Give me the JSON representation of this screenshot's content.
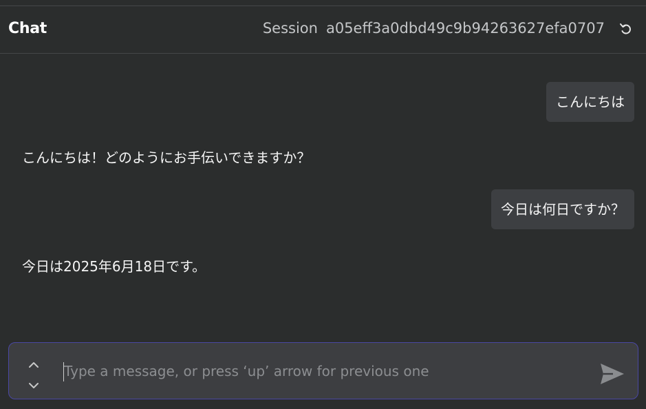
{
  "header": {
    "title": "Chat",
    "session_label": "Session",
    "session_id": "a05eff3a0dbd49c9b94263627efa0707"
  },
  "icons": {
    "reset": "reset-icon",
    "history_up": "chevron-up-icon",
    "history_down": "chevron-down-icon",
    "send": "send-icon"
  },
  "messages": [
    {
      "role": "user",
      "text": "こんにちは"
    },
    {
      "role": "assistant",
      "text": "こんにちは！どのようにお手伝いできますか？"
    },
    {
      "role": "user",
      "text": "今日は何日ですか？"
    },
    {
      "role": "assistant",
      "text": "今日は2025年6月18日です。"
    }
  ],
  "input": {
    "value": "",
    "placeholder": "Type a message, or press ‘up’ arrow for previous one"
  },
  "colors": {
    "background": "#2b2d2d",
    "bubble": "#3d3f42",
    "input_border": "#4a47a3",
    "send_icon": "#8a8c8f"
  }
}
